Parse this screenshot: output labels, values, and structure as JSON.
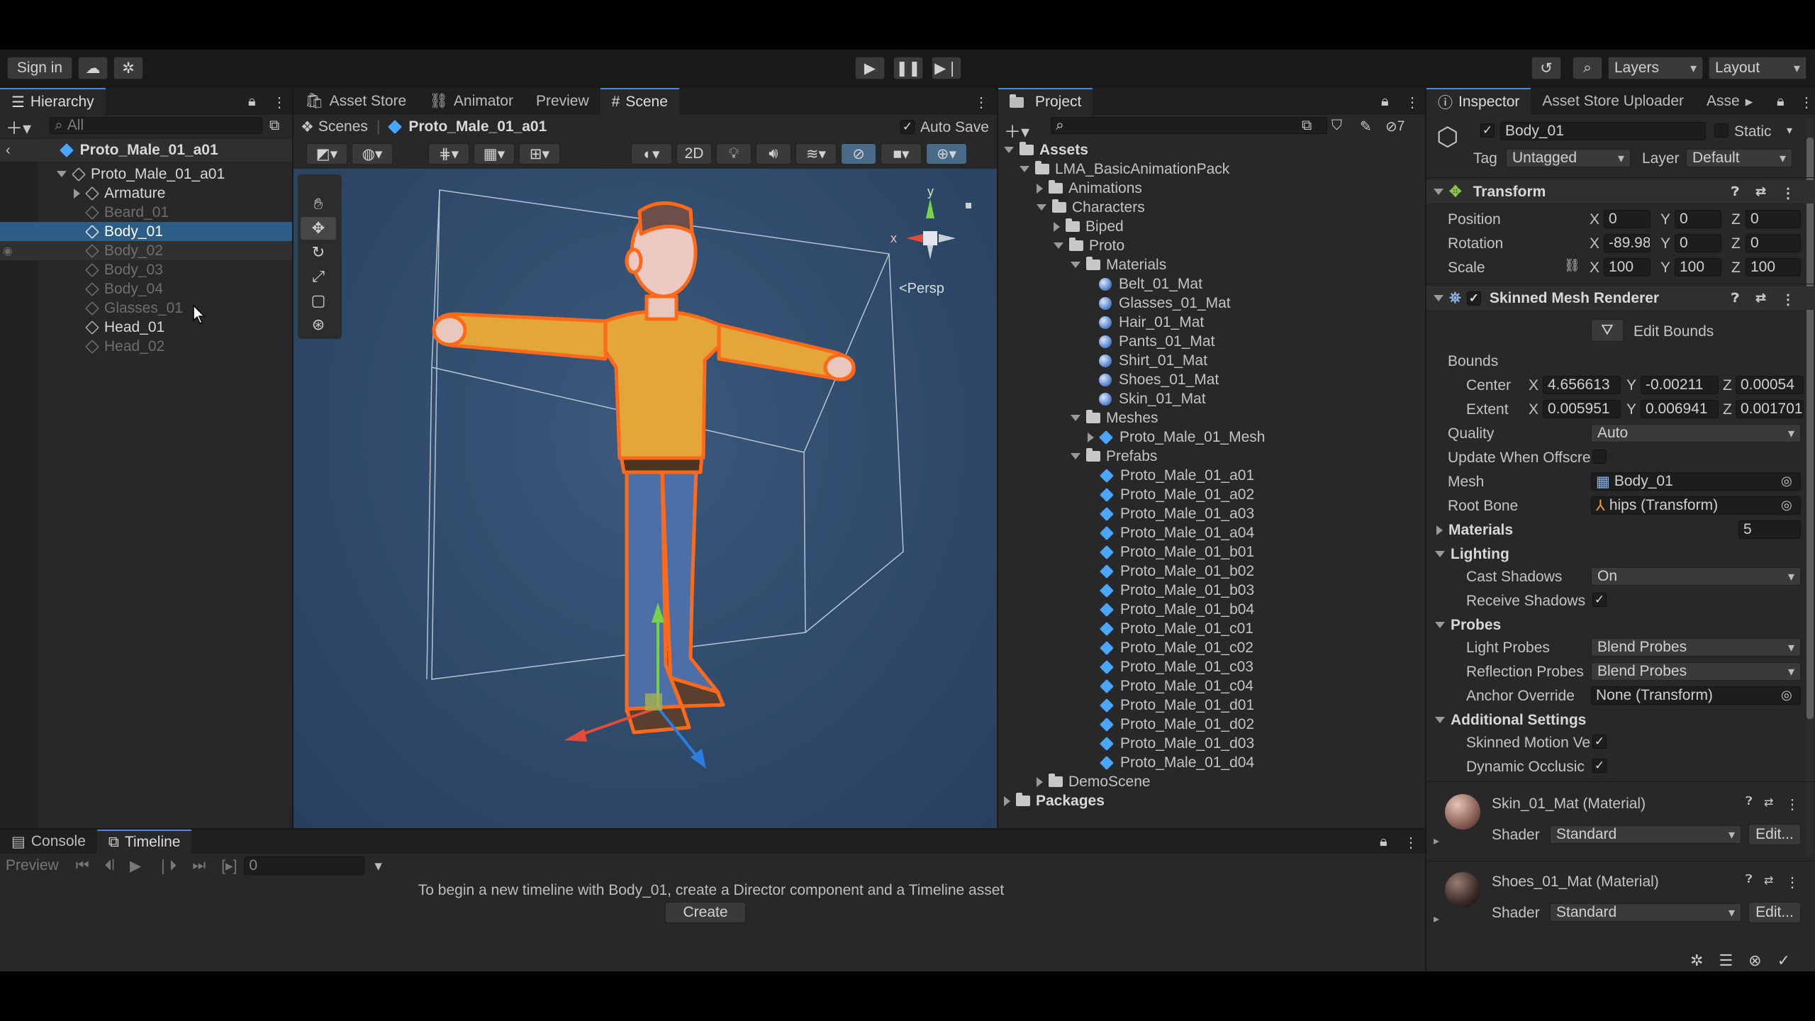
{
  "toolbar": {
    "sign_in": "Sign in",
    "layers": "Layers",
    "layout": "Layout"
  },
  "hierarchy": {
    "tab": "Hierarchy",
    "search_placeholder": "All",
    "scene_root": "Proto_Male_01_a01",
    "items": [
      {
        "label": "Proto_Male_01_a01"
      },
      {
        "label": "Armature"
      },
      {
        "label": "Beard_01"
      },
      {
        "label": "Body_01"
      },
      {
        "label": "Body_02"
      },
      {
        "label": "Body_03"
      },
      {
        "label": "Body_04"
      },
      {
        "label": "Glasses_01"
      },
      {
        "label": "Head_01"
      },
      {
        "label": "Head_02"
      }
    ]
  },
  "scene": {
    "tabs": [
      "Asset Store",
      "Animator",
      "Preview",
      "Scene"
    ],
    "breadcrumb_root": "Scenes",
    "breadcrumb_item": "Proto_Male_01_a01",
    "auto_save": "Auto Save",
    "btn_2d": "2D",
    "gizmo_y": "y",
    "gizmo_x": "x",
    "persp": "<Persp",
    "colors": {
      "background": "#2f4a6a",
      "shirt": "#e3a63b",
      "pants": "#4c6fa8",
      "outline": "#ff6a1a"
    }
  },
  "project": {
    "tab": "Project",
    "hidden_count": "7",
    "tree": [
      {
        "label": "Assets"
      },
      {
        "label": "LMA_BasicAnimationPack"
      },
      {
        "label": "Animations"
      },
      {
        "label": "Characters"
      },
      {
        "label": "Biped"
      },
      {
        "label": "Proto"
      },
      {
        "label": "Materials"
      },
      {
        "label": "Belt_01_Mat"
      },
      {
        "label": "Glasses_01_Mat"
      },
      {
        "label": "Hair_01_Mat"
      },
      {
        "label": "Pants_01_Mat"
      },
      {
        "label": "Shirt_01_Mat"
      },
      {
        "label": "Shoes_01_Mat"
      },
      {
        "label": "Skin_01_Mat"
      },
      {
        "label": "Meshes"
      },
      {
        "label": "Proto_Male_01_Mesh"
      },
      {
        "label": "Prefabs"
      },
      {
        "label": "Proto_Male_01_a01"
      },
      {
        "label": "Proto_Male_01_a02"
      },
      {
        "label": "Proto_Male_01_a03"
      },
      {
        "label": "Proto_Male_01_a04"
      },
      {
        "label": "Proto_Male_01_b01"
      },
      {
        "label": "Proto_Male_01_b02"
      },
      {
        "label": "Proto_Male_01_b03"
      },
      {
        "label": "Proto_Male_01_b04"
      },
      {
        "label": "Proto_Male_01_c01"
      },
      {
        "label": "Proto_Male_01_c02"
      },
      {
        "label": "Proto_Male_01_c03"
      },
      {
        "label": "Proto_Male_01_c04"
      },
      {
        "label": "Proto_Male_01_d01"
      },
      {
        "label": "Proto_Male_01_d02"
      },
      {
        "label": "Proto_Male_01_d03"
      },
      {
        "label": "Proto_Male_01_d04"
      },
      {
        "label": "DemoScene"
      },
      {
        "label": "Packages"
      }
    ]
  },
  "inspector": {
    "tabs": [
      "Inspector",
      "Asset Store Uploader",
      "Asse"
    ],
    "object_name": "Body_01",
    "static": "Static",
    "tag_label": "Tag",
    "tag_value": "Untagged",
    "layer_label": "Layer",
    "layer_value": "Default",
    "transform": {
      "title": "Transform",
      "position_label": "Position",
      "rotation_label": "Rotation",
      "scale_label": "Scale",
      "x": "X",
      "y": "Y",
      "z": "Z",
      "position": [
        "0",
        "0",
        "0"
      ],
      "rotation": [
        "-89.98",
        "0",
        "0"
      ],
      "scale": [
        "100",
        "100",
        "100"
      ]
    },
    "smr": {
      "title": "Skinned Mesh Renderer",
      "edit_bounds": "Edit Bounds",
      "bounds": "Bounds",
      "center_label": "Center",
      "center": [
        "4.656613",
        "-0.00211",
        "0.00054"
      ],
      "extent_label": "Extent",
      "extent": [
        "0.005951",
        "0.006941",
        "0.001701"
      ],
      "quality_label": "Quality",
      "quality": "Auto",
      "update_offscreen": "Update When Offscre",
      "mesh_label": "Mesh",
      "mesh": "Body_01",
      "root_bone_label": "Root Bone",
      "root_bone": "hips (Transform)",
      "materials_label": "Materials",
      "materials_count": "5",
      "lighting": "Lighting",
      "cast_shadows_label": "Cast Shadows",
      "cast_shadows": "On",
      "receive_shadows": "Receive Shadows",
      "probes": "Probes",
      "light_probes_label": "Light Probes",
      "light_probes": "Blend Probes",
      "reflection_probes_label": "Reflection Probes",
      "reflection_probes": "Blend Probes",
      "anchor_label": "Anchor Override",
      "anchor": "None (Transform)",
      "additional": "Additional Settings",
      "skinned_motion": "Skinned Motion Ve",
      "dynamic_occlusion": "Dynamic Occlusic"
    },
    "materials": [
      {
        "name": "Skin_01_Mat (Material)",
        "shader_label": "Shader",
        "shader": "Standard",
        "edit": "Edit..."
      },
      {
        "name": "Shoes_01_Mat (Material)",
        "shader_label": "Shader",
        "shader": "Standard",
        "edit": "Edit..."
      }
    ]
  },
  "bottom": {
    "tabs": [
      "Console",
      "Timeline"
    ],
    "preview": "Preview",
    "frame": "0",
    "message": "To begin a new timeline with Body_01, create a Director component and a Timeline asset",
    "create": "Create"
  }
}
